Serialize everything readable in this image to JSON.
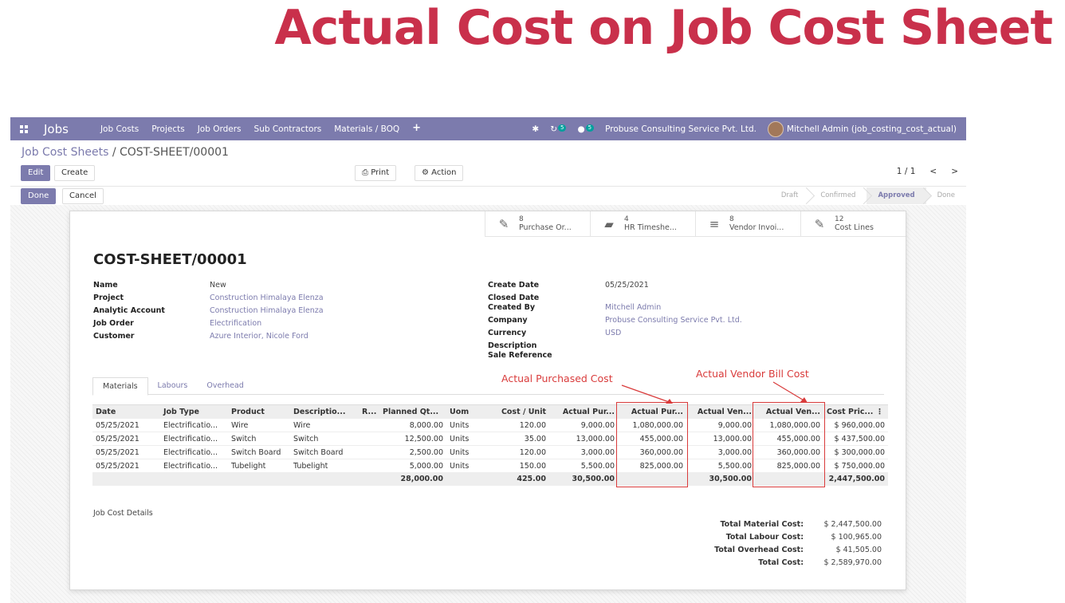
{
  "banner": {
    "title": "Actual Cost on Job Cost Sheet"
  },
  "navbar": {
    "app_name": "Jobs",
    "menu": [
      "Job Costs",
      "Projects",
      "Job Orders",
      "Sub Contractors",
      "Materials / BOQ"
    ],
    "activity_count": "5",
    "message_count": "5",
    "company": "Probuse Consulting Service Pvt. Ltd.",
    "user": "Mitchell Admin (job_costing_cost_actual)"
  },
  "breadcrumb": {
    "parent": "Job Cost Sheets",
    "separator": " / ",
    "current": "COST-SHEET/00001"
  },
  "buttons": {
    "edit": "Edit",
    "create": "Create",
    "print": "Print",
    "action": "Action",
    "done": "Done",
    "cancel": "Cancel"
  },
  "pager": {
    "value": "1 / 1",
    "prev": "<",
    "next": ">"
  },
  "statusbar": [
    "Draft",
    "Confirmed",
    "Approved",
    "Done"
  ],
  "statusbar_active": "Approved",
  "smart_buttons": [
    {
      "count": "8",
      "label": "Purchase Or...",
      "icon": "pencil-square-icon"
    },
    {
      "count": "4",
      "label": "HR Timeshe...",
      "icon": "book-icon"
    },
    {
      "count": "8",
      "label": "Vendor Invoi...",
      "icon": "bars-icon"
    },
    {
      "count": "12",
      "label": "Cost Lines",
      "icon": "pencil-square-icon"
    }
  ],
  "sheet": {
    "title": "COST-SHEET/00001",
    "left_fields": [
      {
        "label": "Name",
        "value": "New"
      },
      {
        "label": "Project",
        "value": "Construction Himalaya Elenza"
      },
      {
        "label": "Analytic Account",
        "value": "Construction Himalaya Elenza"
      },
      {
        "label": "Job Order",
        "value": "Electrification"
      },
      {
        "label": "Customer",
        "value": "Azure Interior, Nicole Ford"
      }
    ],
    "right_fields": [
      {
        "label": "Create Date",
        "value": "05/25/2021"
      },
      {
        "label": "Closed Date",
        "value": ""
      },
      {
        "label": "Created By",
        "value": "Mitchell Admin"
      },
      {
        "label": "Company",
        "value": "Probuse Consulting Service Pvt. Ltd."
      },
      {
        "label": "Currency",
        "value": "USD"
      },
      {
        "label": "Description",
        "value": ""
      },
      {
        "label": "Sale Reference",
        "value": ""
      }
    ]
  },
  "tabs": [
    "Materials",
    "Labours",
    "Overhead"
  ],
  "annotations": {
    "purchased": "Actual Purchased Cost",
    "vendor": "Actual Vendor Bill Cost"
  },
  "table": {
    "headers": [
      "Date",
      "Job Type",
      "Product",
      "Descriptio...",
      "R...",
      "Planned Qt...",
      "Uom",
      "Cost / Unit",
      "Actual Pur...",
      "Actual Pur...",
      "Actual Ven...",
      "Actual Ven...",
      "Cost Pric..."
    ],
    "rows": [
      [
        "05/25/2021",
        "Electrificatio...",
        "Wire",
        "Wire",
        "",
        "8,000.00",
        "Units",
        "120.00",
        "9,000.00",
        "1,080,000.00",
        "9,000.00",
        "1,080,000.00",
        "$ 960,000.00"
      ],
      [
        "05/25/2021",
        "Electrificatio...",
        "Switch",
        "Switch",
        "",
        "12,500.00",
        "Units",
        "35.00",
        "13,000.00",
        "455,000.00",
        "13,000.00",
        "455,000.00",
        "$ 437,500.00"
      ],
      [
        "05/25/2021",
        "Electrificatio...",
        "Switch Board",
        "Switch Board",
        "",
        "2,500.00",
        "Units",
        "120.00",
        "3,000.00",
        "360,000.00",
        "3,000.00",
        "360,000.00",
        "$ 300,000.00"
      ],
      [
        "05/25/2021",
        "Electrificatio...",
        "Tubelight",
        "Tubelight",
        "",
        "5,000.00",
        "Units",
        "150.00",
        "5,500.00",
        "825,000.00",
        "5,500.00",
        "825,000.00",
        "$ 750,000.00"
      ]
    ],
    "totals": [
      "",
      "",
      "",
      "",
      "",
      "28,000.00",
      "",
      "425.00",
      "30,500.00",
      "",
      "30,500.00",
      "",
      "2,447,500.00"
    ]
  },
  "details_label": "Job Cost Details",
  "totals": [
    {
      "label": "Total Material Cost:",
      "value": "$ 2,447,500.00"
    },
    {
      "label": "Total Labour Cost:",
      "value": "$ 100,965.00"
    },
    {
      "label": "Total Overhead Cost:",
      "value": "$ 41,505.00"
    },
    {
      "label": "Total Cost:",
      "value": "$ 2,589,970.00"
    }
  ]
}
